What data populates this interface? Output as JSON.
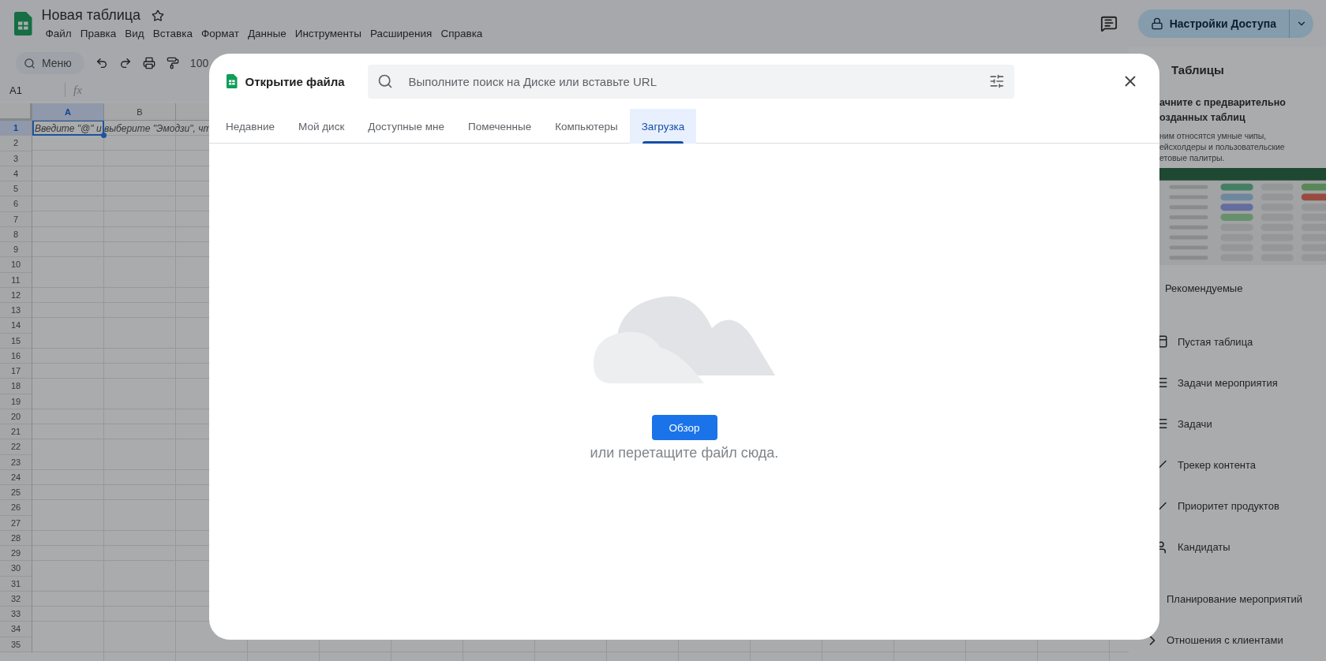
{
  "app": {
    "title": "Новая таблица",
    "starred": false,
    "menu": [
      "Файл",
      "Правка",
      "Вид",
      "Вставка",
      "Формат",
      "Данные",
      "Инструменты",
      "Расширения",
      "Справка"
    ],
    "share_button": "Настройки Доступа"
  },
  "toolbar": {
    "search": "Меню",
    "zoom": "100"
  },
  "formula_bar": {
    "cell_ref": "A1",
    "function_label": "fx"
  },
  "grid": {
    "columns": [
      {
        "label": "A",
        "selected": true
      },
      {
        "label": "B",
        "selected": false
      }
    ],
    "rows": [
      {
        "label": "1",
        "selected": true,
        "text": "Введите \"@\" и выберите \"Эмодзи\", чт"
      },
      {
        "label": "2",
        "selected": false
      },
      {
        "label": "3",
        "selected": false
      },
      {
        "label": "4",
        "selected": false
      },
      {
        "label": "5",
        "selected": false
      },
      {
        "label": "6",
        "selected": false
      },
      {
        "label": "7",
        "selected": false
      },
      {
        "label": "8",
        "selected": false
      },
      {
        "label": "9",
        "selected": false
      },
      {
        "label": "10",
        "selected": false
      },
      {
        "label": "11",
        "selected": false
      },
      {
        "label": "12",
        "selected": false
      },
      {
        "label": "13",
        "selected": false
      },
      {
        "label": "14",
        "selected": false
      },
      {
        "label": "15",
        "selected": false
      },
      {
        "label": "16",
        "selected": false
      },
      {
        "label": "17",
        "selected": false
      },
      {
        "label": "18",
        "selected": false
      },
      {
        "label": "19",
        "selected": false
      },
      {
        "label": "20",
        "selected": false
      },
      {
        "label": "21",
        "selected": false
      },
      {
        "label": "22",
        "selected": false
      },
      {
        "label": "23",
        "selected": false
      },
      {
        "label": "24",
        "selected": false
      },
      {
        "label": "25",
        "selected": false
      },
      {
        "label": "26",
        "selected": false
      },
      {
        "label": "27",
        "selected": false
      },
      {
        "label": "28",
        "selected": false
      },
      {
        "label": "29",
        "selected": false
      },
      {
        "label": "30",
        "selected": false
      },
      {
        "label": "31",
        "selected": false
      },
      {
        "label": "32",
        "selected": false
      },
      {
        "label": "33",
        "selected": false
      },
      {
        "label": "34",
        "selected": false
      },
      {
        "label": "35",
        "selected": false
      }
    ]
  },
  "side_panel": {
    "title": "Таблицы",
    "intro_title_lines": [
      "ачните с предварительно",
      "озданных таблиц"
    ],
    "intro_text_lines": [
      "ним относятся умные чипы,",
      "ейсхолдеры и пользовательские",
      "етовые палитры."
    ],
    "section": "Рекомендуемые",
    "templates": [
      {
        "label": "Пустая таблица",
        "kind": "blank"
      },
      {
        "label": "Задачи мероприятия",
        "kind": "list"
      },
      {
        "label": "Задачи",
        "kind": "list"
      },
      {
        "label": "Трекер контента",
        "kind": "check"
      },
      {
        "label": "Приоритет продуктов",
        "kind": "check"
      },
      {
        "label": "Кандидаты",
        "kind": "person"
      }
    ],
    "categories": [
      {
        "label": "Планирование мероприятий"
      },
      {
        "label": "Отношения с клиентами",
        "expanded": false
      }
    ]
  },
  "dialog": {
    "title": "Открытие файла",
    "search_placeholder": "Выполните поиск на Диске или вставьте URL",
    "tabs": [
      {
        "label": "Недавние",
        "selected": false
      },
      {
        "label": "Мой диск",
        "selected": false
      },
      {
        "label": "Доступные мне",
        "selected": false
      },
      {
        "label": "Помеченные",
        "selected": false
      },
      {
        "label": "Компьютеры",
        "selected": false
      },
      {
        "label": "Загрузка",
        "selected": true
      }
    ],
    "upload": {
      "button": "Обзор",
      "hint": "или перетащите файл сюда."
    }
  }
}
